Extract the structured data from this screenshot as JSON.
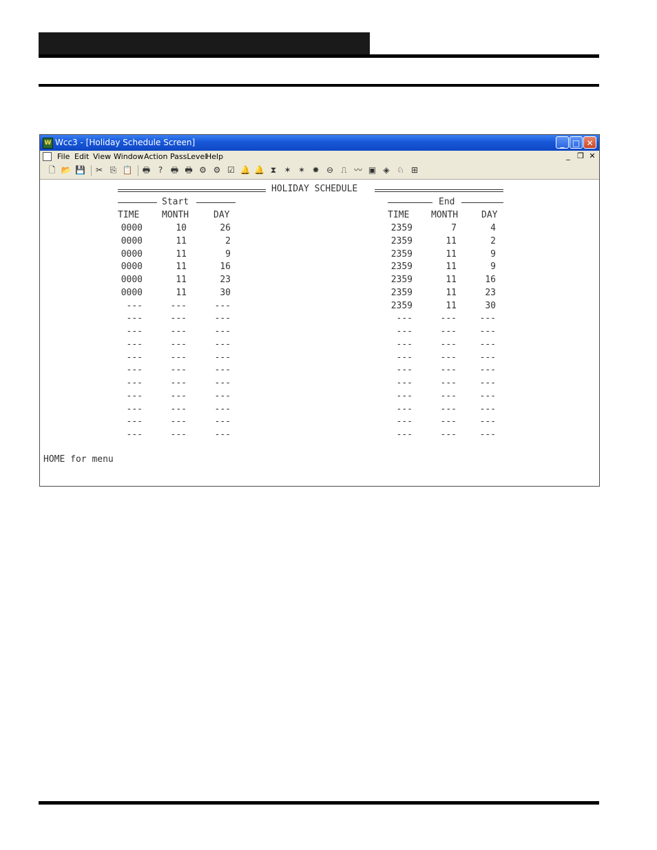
{
  "window": {
    "title": "Wcc3 - [Holiday Schedule Screen]",
    "icon": "W",
    "buttons": {
      "minimize": "_",
      "maximize": "□",
      "close": "✕"
    }
  },
  "menu": {
    "items": [
      "File",
      "Edit",
      "View",
      "Window",
      "Action",
      "PassLevel",
      "Help"
    ],
    "mdi": {
      "minimize": "_",
      "restore": "❐",
      "close": "✕"
    }
  },
  "toolbar": {
    "icons": [
      "new-icon",
      "open-icon",
      "save-icon",
      "cut-icon",
      "copy-icon",
      "paste-icon",
      "print-icon",
      "help-icon",
      "print-setup-icon",
      "print-preview-icon",
      "tool-a-icon",
      "tool-b-icon",
      "tool-c-icon",
      "bell-icon",
      "bell-alt-icon",
      "hourglass-icon",
      "star-icon",
      "star-alt-icon",
      "badge-icon",
      "key-icon",
      "chart-icon",
      "trend-icon",
      "display-icon",
      "eye-icon",
      "network-icon",
      "tree-icon"
    ],
    "glyphs": [
      "🗋",
      "📂",
      "💾",
      "✂",
      "⎘",
      "📋",
      "🖶",
      "?",
      "🖶",
      "🖶",
      "⚙",
      "⚙",
      "☑",
      "🔔",
      "🔔",
      "⧗",
      "✶",
      "✶",
      "✹",
      "⊖",
      "⎍",
      "〰",
      "▣",
      "◈",
      "♘",
      "⊞"
    ]
  },
  "schedule": {
    "title": "HOLIDAY SCHEDULE",
    "start_label": "Start",
    "end_label": "End",
    "headers": {
      "time": "TIME",
      "month": "MONTH",
      "day": "DAY"
    },
    "rows": [
      {
        "start": [
          "0000",
          "10",
          "26"
        ],
        "end": [
          "2359",
          "7",
          "4"
        ]
      },
      {
        "start": [
          "0000",
          "11",
          "2"
        ],
        "end": [
          "2359",
          "11",
          "2"
        ]
      },
      {
        "start": [
          "0000",
          "11",
          "9"
        ],
        "end": [
          "2359",
          "11",
          "9"
        ]
      },
      {
        "start": [
          "0000",
          "11",
          "16"
        ],
        "end": [
          "2359",
          "11",
          "9"
        ]
      },
      {
        "start": [
          "0000",
          "11",
          "23"
        ],
        "end": [
          "2359",
          "11",
          "16"
        ]
      },
      {
        "start": [
          "0000",
          "11",
          "30"
        ],
        "end": [
          "2359",
          "11",
          "23"
        ]
      },
      {
        "start": [
          "---",
          "---",
          "---"
        ],
        "end": [
          "2359",
          "11",
          "30"
        ]
      },
      {
        "start": [
          "---",
          "---",
          "---"
        ],
        "end": [
          "---",
          "---",
          "---"
        ]
      },
      {
        "start": [
          "---",
          "---",
          "---"
        ],
        "end": [
          "---",
          "---",
          "---"
        ]
      },
      {
        "start": [
          "---",
          "---",
          "---"
        ],
        "end": [
          "---",
          "---",
          "---"
        ]
      },
      {
        "start": [
          "---",
          "---",
          "---"
        ],
        "end": [
          "---",
          "---",
          "---"
        ]
      },
      {
        "start": [
          "---",
          "---",
          "---"
        ],
        "end": [
          "---",
          "---",
          "---"
        ]
      },
      {
        "start": [
          "---",
          "---",
          "---"
        ],
        "end": [
          "---",
          "---",
          "---"
        ]
      },
      {
        "start": [
          "---",
          "---",
          "---"
        ],
        "end": [
          "---",
          "---",
          "---"
        ]
      },
      {
        "start": [
          "---",
          "---",
          "---"
        ],
        "end": [
          "---",
          "---",
          "---"
        ]
      },
      {
        "start": [
          "---",
          "---",
          "---"
        ],
        "end": [
          "---",
          "---",
          "---"
        ]
      },
      {
        "start": [
          "---",
          "---",
          "---"
        ],
        "end": [
          "---",
          "---",
          "---"
        ]
      }
    ],
    "footer": "HOME for menu"
  }
}
